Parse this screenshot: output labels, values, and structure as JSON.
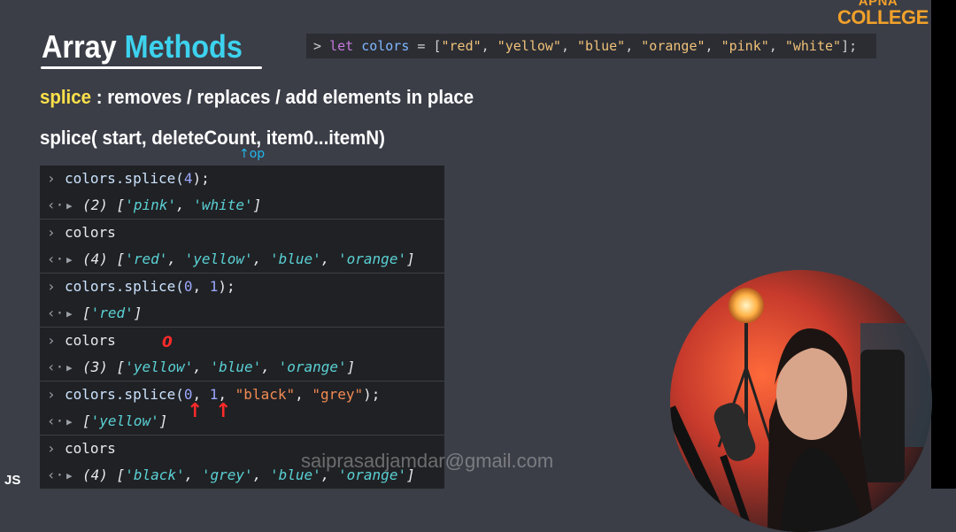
{
  "brand": {
    "top": "APNA",
    "bottom": "COLLEGE"
  },
  "slide": {
    "title_part1": "Array",
    "title_part2": "Methods",
    "declaration": {
      "prompt": ">",
      "keyword": "let",
      "var": "colors",
      "rest_prefix": " = [",
      "items": [
        "\"red\"",
        "\"yellow\"",
        "\"blue\"",
        "\"orange\"",
        "\"pink\"",
        "\"white\""
      ],
      "rest_suffix": "];"
    },
    "description": {
      "method": "splice",
      "text": " : removes / replaces / add elements in place"
    },
    "signature": "splice( start, deleteCount, item0...itemN)"
  },
  "console": {
    "rows": [
      {
        "type": "input",
        "fn": "colors.splice(",
        "args": [
          {
            "t": "num",
            "v": "4"
          }
        ],
        "close": ");"
      },
      {
        "type": "output",
        "count": "(2)",
        "items": [
          "'pink'",
          "'white'"
        ]
      },
      {
        "type": "input",
        "plain": "colors"
      },
      {
        "type": "output",
        "count": "(4)",
        "items": [
          "'red'",
          "'yellow'",
          "'blue'",
          "'orange'"
        ]
      },
      {
        "type": "input",
        "fn": "colors.splice(",
        "args": [
          {
            "t": "num",
            "v": "0"
          },
          {
            "t": "sep",
            "v": ", "
          },
          {
            "t": "num",
            "v": "1"
          }
        ],
        "close": ");"
      },
      {
        "type": "output",
        "count": "",
        "items": [
          "'red'"
        ]
      },
      {
        "type": "input",
        "plain": "colors"
      },
      {
        "type": "output",
        "count": "(3)",
        "items": [
          "'yellow'",
          "'blue'",
          "'orange'"
        ]
      },
      {
        "type": "input",
        "fn": "colors.splice(",
        "args": [
          {
            "t": "num",
            "v": "0"
          },
          {
            "t": "sep",
            "v": ", "
          },
          {
            "t": "num",
            "v": "1"
          },
          {
            "t": "sep",
            "v": ", "
          },
          {
            "t": "dq",
            "v": "\"black\""
          },
          {
            "t": "sep",
            "v": ", "
          },
          {
            "t": "dq",
            "v": "\"grey\""
          }
        ],
        "close": ");"
      },
      {
        "type": "output",
        "count": "",
        "items": [
          "'yellow'"
        ]
      },
      {
        "type": "input",
        "plain": "colors"
      },
      {
        "type": "output",
        "count": "(4)",
        "items": [
          "'black'",
          "'grey'",
          "'blue'",
          "'orange'"
        ]
      }
    ]
  },
  "annotations": {
    "op": "op",
    "zero": "0"
  },
  "watermark": "saiprasadjamdar@gmail.com",
  "corner_label": "JS"
}
